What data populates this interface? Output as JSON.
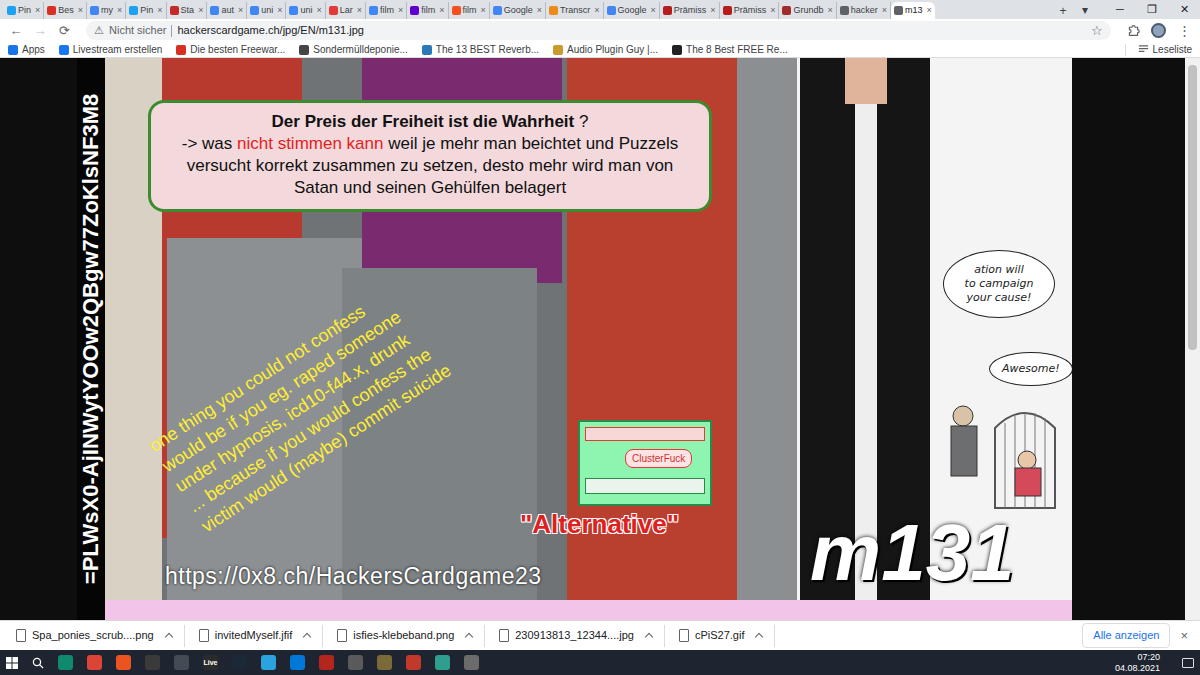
{
  "tab_strip": {
    "tabs": [
      {
        "label": "Pin",
        "selected": false,
        "color": "#1da1f2"
      },
      {
        "label": "Bes",
        "selected": false,
        "color": "#d93025"
      },
      {
        "label": "my",
        "selected": false,
        "color": "#4285f4"
      },
      {
        "label": "Pin",
        "selected": false,
        "color": "#1da1f2"
      },
      {
        "label": "Sta",
        "selected": false,
        "color": "#c62828"
      },
      {
        "label": "aut",
        "selected": false,
        "color": "#4285f4"
      },
      {
        "label": "uni",
        "selected": false,
        "color": "#4285f4"
      },
      {
        "label": "uni",
        "selected": false,
        "color": "#4285f4"
      },
      {
        "label": "Lar",
        "selected": false,
        "color": "#e53935"
      },
      {
        "label": "film",
        "selected": false,
        "color": "#4285f4"
      },
      {
        "label": "film",
        "selected": false,
        "color": "#6001d2"
      },
      {
        "label": "film",
        "selected": false,
        "color": "#f4511e"
      },
      {
        "label": "Google",
        "selected": false,
        "color": "#4285f4"
      },
      {
        "label": "Transcr",
        "selected": false,
        "color": "#ef8a17"
      },
      {
        "label": "Google",
        "selected": false,
        "color": "#4285f4"
      },
      {
        "label": "Prämiss",
        "selected": false,
        "color": "#b71c1c"
      },
      {
        "label": "Prämiss",
        "selected": false,
        "color": "#b71c1c"
      },
      {
        "label": "Grundb",
        "selected": false,
        "color": "#a12a2a"
      },
      {
        "label": "hacker",
        "selected": false,
        "color": "#5f6368"
      },
      {
        "label": "m13",
        "selected": true,
        "color": "#5f6368"
      }
    ],
    "close_glyph": "×",
    "new_tab": "+",
    "tab_search": "▾"
  },
  "window_controls": [
    "─",
    "❐",
    "✕"
  ],
  "toolbar": {
    "nav": [
      {
        "glyph": "←",
        "disabled": false
      },
      {
        "glyph": "→",
        "disabled": true
      },
      {
        "glyph": "⟳",
        "disabled": false
      }
    ],
    "security_glyph": "⚠",
    "security": "Nicht sicher",
    "url": "hackerscardgame.ch/jpg/EN/m131.jpg",
    "star": "☆",
    "menu": "⋮"
  },
  "bookmarks": {
    "items": [
      {
        "label": "Apps",
        "color": "#1a73e8"
      },
      {
        "label": "Livestream erstellen",
        "color": "#1877f2"
      },
      {
        "label": "Die besten Freewar...",
        "color": "#d93025"
      },
      {
        "label": "Sondermülldeponie...",
        "color": "#444444"
      },
      {
        "label": "The 13 BEST Reverb...",
        "color": "#2a7ab8"
      },
      {
        "label": "Audio Plugin Guy |...",
        "color": "#c99a2e"
      },
      {
        "label": "The 8 Best FREE Re...",
        "color": "#222222"
      }
    ],
    "reading_list": "Leseliste"
  },
  "image": {
    "side_code": "=PLWsX0-AjINWytYOOw2QBgw77ZoKlsNF3M8",
    "banner": {
      "title": "Der Preis der Freiheit ist die Wahrheit",
      "title_suffix": " ?",
      "parts": [
        {
          "text": "-> was ",
          "emphasis": false
        },
        {
          "text": "nicht stimmen kann",
          "emphasis": true
        },
        {
          "text": " weil je mehr man beichtet und Puzzels versucht korrekt zusammen zu setzen, desto mehr wird man von Satan und seinen Gehülfen belagert",
          "emphasis": false
        }
      ]
    },
    "diagonal_note": [
      "one thing you could not confess",
      "would be if you eg. raped someone",
      "under hypnosis, icd10-f44.x, drunk",
      "... because if you would confess the",
      "victim would (maybe) commit suicide"
    ],
    "green_card": "ClusterFuck",
    "tag": "\"Alternative\"",
    "link": "https://0x8.ch/HackersCardgame23",
    "card_id": "m131",
    "bubbles": [
      [
        "ation will",
        "to campaign",
        "your cause!"
      ],
      [
        "Awesome!"
      ]
    ]
  },
  "scrollbar": {
    "level": 0.52
  },
  "downloads": {
    "items": [
      "Spa_ponies_scrub....png",
      "invitedMyself.jfif",
      "isfies-klebeband.png",
      "230913813_12344....jpg",
      "cPiS27.gif"
    ],
    "show_all": "Alle anzeigen",
    "close": "×"
  },
  "taskbar": {
    "apps": [
      {
        "color": "#0f8a6c"
      },
      {
        "color": "#db4437"
      },
      {
        "color": "#e95420"
      },
      {
        "color": "#3a3a3a"
      },
      {
        "color": "#444b55"
      },
      {
        "color": "#2b2b2b",
        "label": "Live"
      },
      {
        "color": "#1b2838"
      },
      {
        "color": "#2aa3de"
      },
      {
        "color": "#0078d7"
      },
      {
        "color": "#b3261e"
      },
      {
        "color": "#5a5a5a"
      },
      {
        "color": "#7a6a3a"
      },
      {
        "color": "#c0392b"
      },
      {
        "color": "#2e9e8f"
      },
      {
        "color": "#6b6b6b"
      }
    ],
    "time": "07:20",
    "date": "04.08.2021"
  }
}
